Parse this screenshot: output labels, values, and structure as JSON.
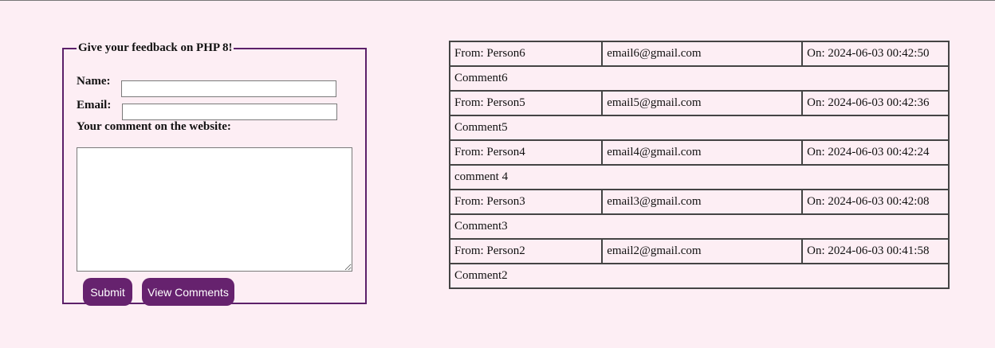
{
  "form": {
    "legend": "Give your feedback on PHP 8!",
    "name_label": "Name:",
    "name_value": "",
    "email_label": "Email:",
    "email_value": "",
    "comment_label": "Your comment on the website:",
    "comment_value": "",
    "submit_label": "Submit",
    "view_label": "View Comments"
  },
  "comments": [
    {
      "from": "From: Person6",
      "email": "email6@gmail.com",
      "on": "On: 2024-06-03 00:42:50",
      "text": "Comment6"
    },
    {
      "from": "From: Person5",
      "email": "email5@gmail.com",
      "on": "On: 2024-06-03 00:42:36",
      "text": "Comment5"
    },
    {
      "from": "From: Person4",
      "email": "email4@gmail.com",
      "on": "On: 2024-06-03 00:42:24",
      "text": "comment 4"
    },
    {
      "from": "From: Person3",
      "email": "email3@gmail.com",
      "on": "On: 2024-06-03 00:42:08",
      "text": "Comment3"
    },
    {
      "from": "From: Person2",
      "email": "email2@gmail.com",
      "on": "On: 2024-06-03 00:41:58",
      "text": "Comment2"
    }
  ],
  "colors": {
    "background": "#fdeef4",
    "accent": "#66226e",
    "border": "#5c2069"
  }
}
